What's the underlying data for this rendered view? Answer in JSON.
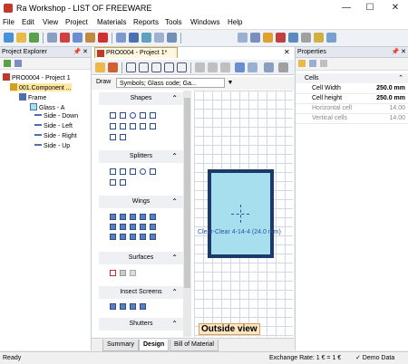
{
  "window": {
    "title": "Ra Workshop - LIST OF FREEWARE",
    "min": "—",
    "max": "☐",
    "close": "✕"
  },
  "menu": [
    "File",
    "Edit",
    "View",
    "Project",
    "Materials",
    "Reports",
    "Tools",
    "Windows",
    "Help"
  ],
  "explorer": {
    "title": "Project Explorer",
    "pin": "📌 ✕",
    "tree": {
      "project": "PRO0004 - Project 1",
      "component": "001.Component ...",
      "frame": "Frame",
      "glass": "Glass - A",
      "sides": [
        "Side - Down",
        "Side - Left",
        "Side - Right",
        "Side - Up"
      ]
    }
  },
  "document": {
    "tab": "PRO0004 - Project 1*",
    "draw_label": "Draw",
    "draw_select": "Symbols; Glass code; Ga...",
    "toolbox": {
      "sections": [
        "Shapes",
        "Splitters",
        "Wings",
        "Surfaces",
        "Insect Screens",
        "Shutters"
      ]
    },
    "glass_label": "Clear-Clear 4-14-4 (24.0 mm)",
    "outside_view": "Outside view",
    "bottom_tabs": [
      "Summary",
      "Design",
      "Bill of Material"
    ]
  },
  "properties": {
    "title": "Properties",
    "group": "Cells",
    "rows": [
      {
        "k": "Cell Width",
        "v": "250.0 mm",
        "bold": true
      },
      {
        "k": "Cell height",
        "v": "250.0 mm",
        "bold": true
      },
      {
        "k": "Horizontal cell",
        "v": "14.00",
        "bold": false
      },
      {
        "k": "Vertical cells",
        "v": "14.00",
        "bold": false
      }
    ]
  },
  "status": {
    "left": "Ready",
    "exchange": "Exchange Rate: 1 € = 1 €",
    "demo": "✓ Demo Data"
  },
  "colors": {
    "frame": "#1a3a6a",
    "glass": "#a8dfee",
    "accent": "#2a4f88"
  }
}
